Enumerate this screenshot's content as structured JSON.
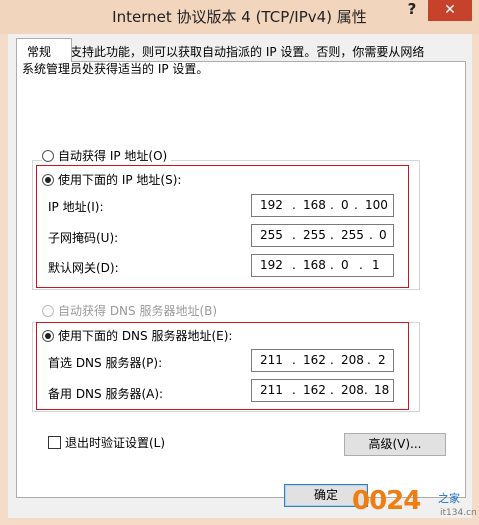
{
  "window": {
    "title": "Internet 协议版本 4 (TCP/IPv4) 属性",
    "help": "?",
    "close": "✕"
  },
  "tab": {
    "label": "常规"
  },
  "description": "如果网络支持此功能，则可以获取自动指派的 IP 设置。否则，你需要从网络系统管理员处获得适当的 IP 设置。",
  "ip": {
    "auto_label": "自动获得 IP 地址(O)",
    "manual_label": "使用下面的 IP 地址(S):",
    "selected": "manual",
    "fields": [
      {
        "label": "IP 地址(I):",
        "octets": [
          "192",
          "168",
          "0",
          "100"
        ]
      },
      {
        "label": "子网掩码(U):",
        "octets": [
          "255",
          "255",
          "255",
          "0"
        ]
      },
      {
        "label": "默认网关(D):",
        "octets": [
          "192",
          "168",
          "0",
          "1"
        ]
      }
    ]
  },
  "dns": {
    "auto_label": "自动获得 DNS 服务器地址(B)",
    "manual_label": "使用下面的 DNS 服务器地址(E):",
    "selected": "manual",
    "fields": [
      {
        "label": "首选 DNS 服务器(P):",
        "octets": [
          "211",
          "162",
          "208",
          "2"
        ]
      },
      {
        "label": "备用 DNS 服务器(A):",
        "octets": [
          "211",
          "162",
          "208",
          "18"
        ]
      }
    ]
  },
  "validate": {
    "label": "退出时验证设置(L)",
    "checked": false
  },
  "buttons": {
    "advanced": "高级(V)...",
    "ok": "确定"
  },
  "watermark": {
    "main": "0024",
    "small": "之家",
    "url": "it134.cn"
  },
  "colors": {
    "highlight_border": "#c8161d",
    "close_button": "#c7422b"
  }
}
